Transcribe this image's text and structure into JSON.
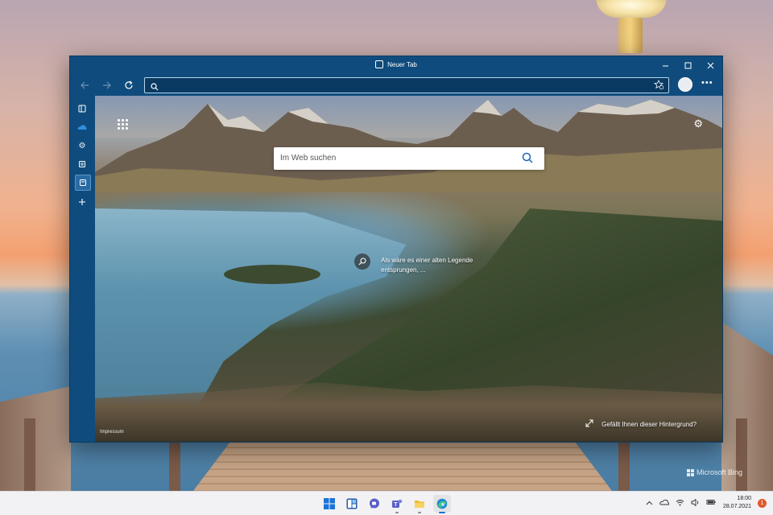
{
  "window": {
    "tab_title": "Neuer Tab",
    "controls": [
      "minimize",
      "maximize",
      "close"
    ]
  },
  "toolbar": {
    "address_value": "",
    "icons": [
      "back-icon",
      "forward-icon",
      "refresh-icon",
      "search-icon",
      "favorites-add-icon",
      "profile-avatar",
      "more-icon"
    ]
  },
  "sidebar": {
    "items": [
      {
        "name": "tab-actions-icon",
        "active": false
      },
      {
        "name": "onedrive-icon",
        "active": false
      },
      {
        "name": "settings-icon",
        "active": false
      },
      {
        "name": "collections-icon",
        "active": false
      },
      {
        "name": "new-tab-icon",
        "active": true
      },
      {
        "name": "add-icon",
        "active": false
      }
    ]
  },
  "ntp": {
    "search_placeholder": "Im Web suchen",
    "image_caption": "Als wäre es einer alten Legende entsprungen, ...",
    "impressum": "Impressum",
    "like_question": "Gefällt Ihnen dieser Hintergrund?"
  },
  "wallpaper": {
    "watermark": "Microsoft Bing"
  },
  "taskbar": {
    "apps": [
      "start-icon",
      "widgets-icon",
      "chat-icon",
      "teams-icon",
      "file-explorer-icon",
      "edge-icon"
    ],
    "active_app": "edge-icon",
    "time": "18:00",
    "date": "28.07.2021",
    "notification_count": "1"
  },
  "colors": {
    "window_chrome": "#0f4c7d",
    "taskbar": "#f2f2f4",
    "notification_badge": "#e05a2b"
  }
}
